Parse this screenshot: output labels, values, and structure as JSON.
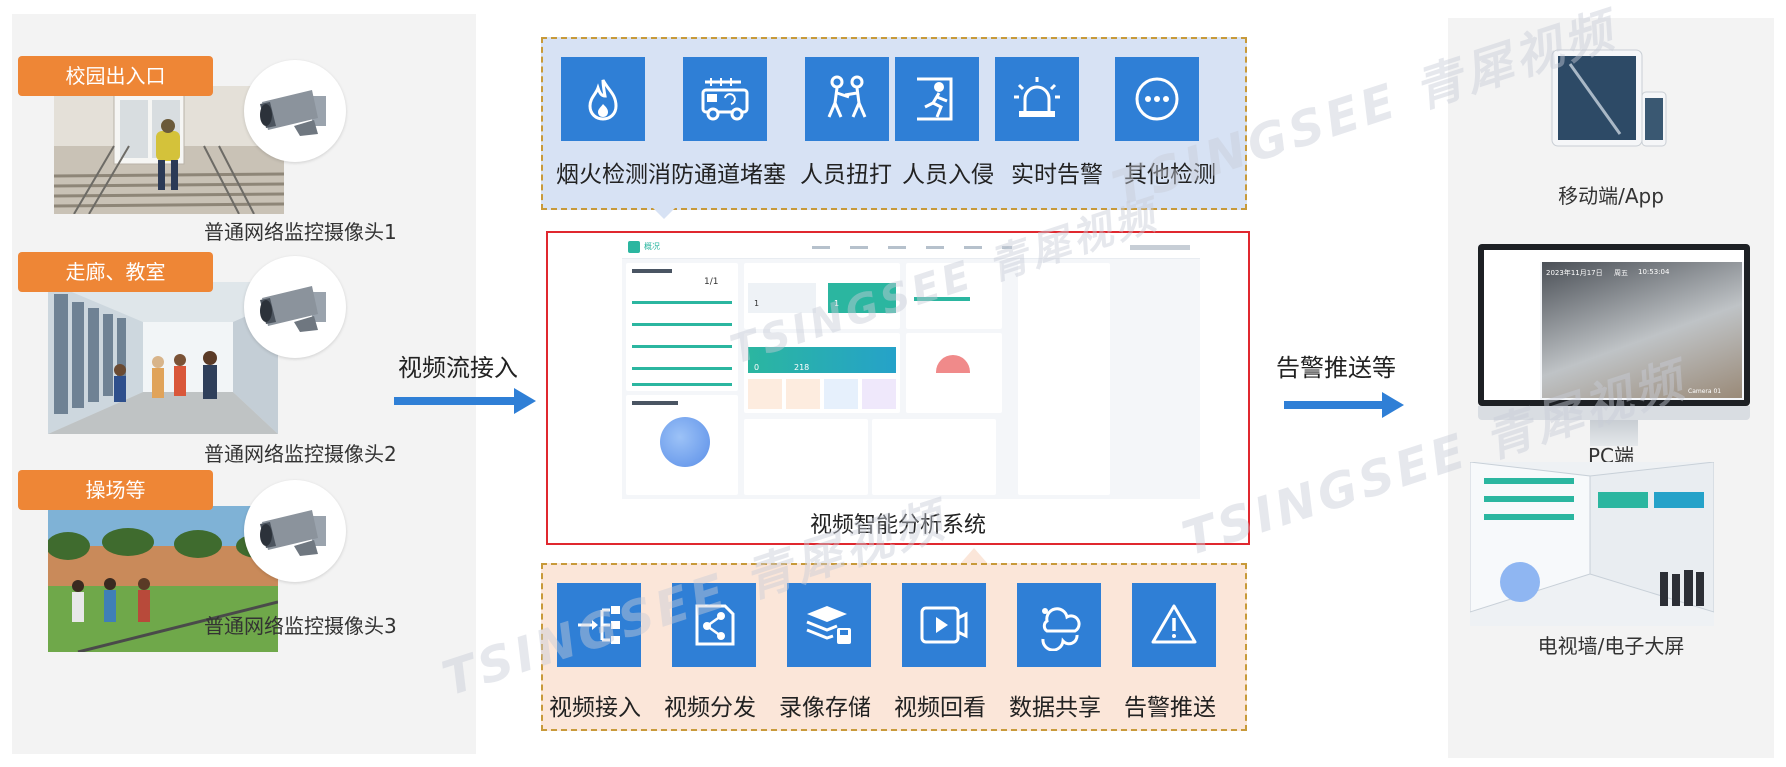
{
  "sources": [
    {
      "tag": "校园出入口",
      "caption": "普通网络监控摄像头1"
    },
    {
      "tag": "走廊、教室",
      "caption": "普通网络监控摄像头2"
    },
    {
      "tag": "操场等",
      "caption": "普通网络监控摄像头3"
    }
  ],
  "arrows": {
    "input_label": "视频流接入",
    "output_label": "告警推送等"
  },
  "detections": [
    {
      "label": "烟火检测",
      "icon": "flame-icon"
    },
    {
      "label": "消防通道堵塞",
      "icon": "fire-truck-icon"
    },
    {
      "label": "人员扭打",
      "icon": "fighting-people-icon"
    },
    {
      "label": "人员入侵",
      "icon": "intrusion-icon"
    },
    {
      "label": "实时告警",
      "icon": "alarm-light-icon"
    },
    {
      "label": "其他检测",
      "icon": "more-icon"
    }
  ],
  "system": {
    "title": "视频智能分析系统",
    "dashboard": {
      "nav_title": "概况",
      "stat_card_value": "1/1",
      "summary_values": [
        "1",
        "1",
        "0",
        "218"
      ]
    }
  },
  "capabilities": [
    {
      "label": "视频接入",
      "icon": "video-input-icon"
    },
    {
      "label": "视频分发",
      "icon": "share-icon"
    },
    {
      "label": "录像存储",
      "icon": "storage-icon"
    },
    {
      "label": "视频回看",
      "icon": "playback-icon"
    },
    {
      "label": "数据共享",
      "icon": "cloud-share-icon"
    },
    {
      "label": "告警推送",
      "icon": "warning-icon"
    }
  ],
  "outputs": [
    {
      "caption": "移动端/App"
    },
    {
      "caption": "PC端",
      "screen_date": "2023年11月17日",
      "screen_weekday": "周五",
      "screen_time": "10:53:04",
      "screen_camera": "Camera 01"
    },
    {
      "caption": "电视墙/电子大屏"
    }
  ],
  "watermark": "TSINGSEE 青犀视频",
  "colors": {
    "tag_orange": "#ee8636",
    "tile_blue": "#2f7fd6",
    "detect_bg": "#d7e2f4",
    "cap_bg": "#fbe6d9",
    "system_border": "#e0282f",
    "arrow_blue": "#2f7fd6"
  }
}
